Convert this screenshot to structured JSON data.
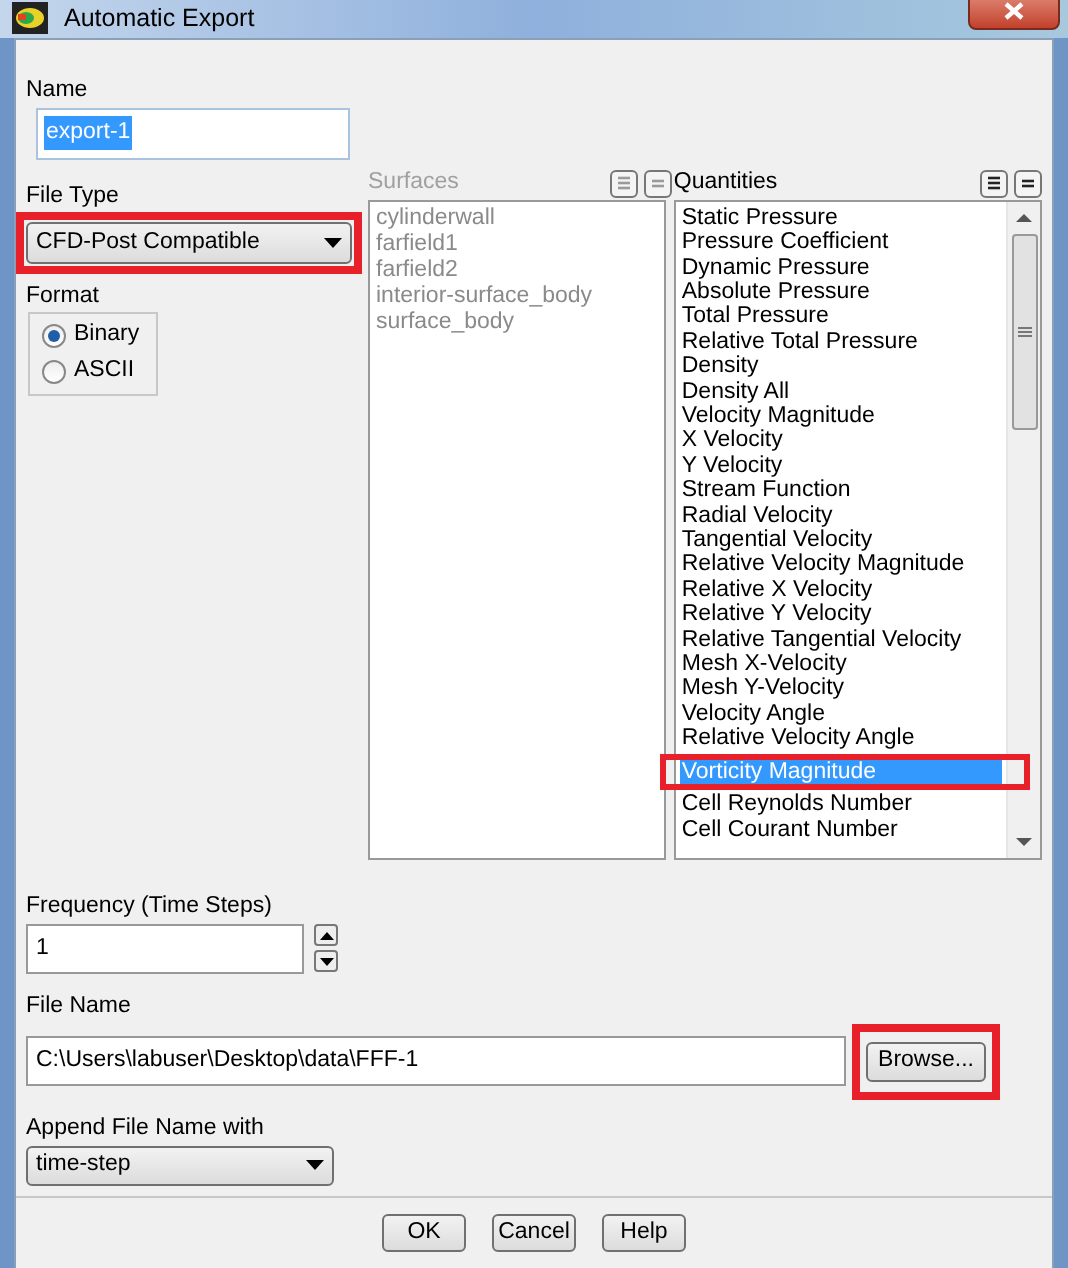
{
  "window": {
    "title": "Automatic Export"
  },
  "name": {
    "label": "Name",
    "value": "export-1",
    "text_selected": true
  },
  "file_type": {
    "label": "File Type",
    "value": "CFD-Post Compatible",
    "highlighted": true
  },
  "format": {
    "label": "Format",
    "options": [
      {
        "label": "Binary",
        "selected": true
      },
      {
        "label": "ASCII",
        "selected": false
      }
    ]
  },
  "surfaces": {
    "label": "Surfaces",
    "disabled": true,
    "items": [
      {
        "label": "cylinderwall",
        "selected": false
      },
      {
        "label": "farfield1",
        "selected": false
      },
      {
        "label": "farfield2",
        "selected": false
      },
      {
        "label": "interior-surface_body",
        "selected": false
      },
      {
        "label": "surface_body",
        "selected": false
      }
    ]
  },
  "quantities": {
    "label": "Quantities",
    "disabled": false,
    "items": [
      {
        "label": "Static Pressure",
        "selected": false,
        "highlighted": false
      },
      {
        "label": "Pressure Coefficient",
        "selected": false,
        "highlighted": false
      },
      {
        "label": "Dynamic Pressure",
        "selected": false,
        "highlighted": false
      },
      {
        "label": "Absolute Pressure",
        "selected": false,
        "highlighted": false
      },
      {
        "label": "Total Pressure",
        "selected": false,
        "highlighted": false
      },
      {
        "label": "Relative Total Pressure",
        "selected": false,
        "highlighted": false
      },
      {
        "label": "Density",
        "selected": false,
        "highlighted": false
      },
      {
        "label": "Density All",
        "selected": false,
        "highlighted": false
      },
      {
        "label": "Velocity Magnitude",
        "selected": false,
        "highlighted": false
      },
      {
        "label": "X Velocity",
        "selected": false,
        "highlighted": false
      },
      {
        "label": "Y Velocity",
        "selected": false,
        "highlighted": false
      },
      {
        "label": "Stream Function",
        "selected": false,
        "highlighted": false
      },
      {
        "label": "Radial Velocity",
        "selected": false,
        "highlighted": false
      },
      {
        "label": "Tangential Velocity",
        "selected": false,
        "highlighted": false
      },
      {
        "label": "Relative Velocity Magnitude",
        "selected": false,
        "highlighted": false
      },
      {
        "label": "Relative X Velocity",
        "selected": false,
        "highlighted": false
      },
      {
        "label": "Relative Y Velocity",
        "selected": false,
        "highlighted": false
      },
      {
        "label": "Relative Tangential Velocity",
        "selected": false,
        "highlighted": false
      },
      {
        "label": "Mesh X-Velocity",
        "selected": false,
        "highlighted": false
      },
      {
        "label": "Mesh Y-Velocity",
        "selected": false,
        "highlighted": false
      },
      {
        "label": "Velocity Angle",
        "selected": false,
        "highlighted": false
      },
      {
        "label": "Relative Velocity Angle",
        "selected": false,
        "highlighted": false
      },
      {
        "label": "Vorticity Magnitude",
        "selected": true,
        "highlighted": true
      },
      {
        "label": "Cell Reynolds Number",
        "selected": false,
        "highlighted": false
      },
      {
        "label": "Cell Courant Number",
        "selected": false,
        "highlighted": false
      }
    ]
  },
  "frequency": {
    "label": "Frequency (Time Steps)",
    "value": "1"
  },
  "file_name": {
    "label": "File Name",
    "value": "C:\\Users\\labuser\\Desktop\\data\\FFF-1",
    "browse": "Browse...",
    "browse_highlighted": true
  },
  "append": {
    "label": "Append File Name with",
    "value": "time-step"
  },
  "buttons": [
    "OK",
    "Cancel",
    "Help"
  ]
}
